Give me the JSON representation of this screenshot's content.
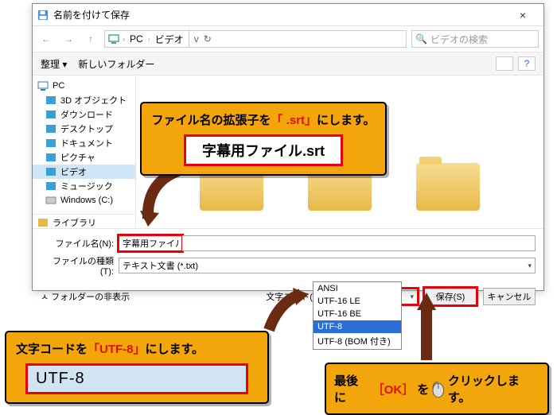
{
  "window": {
    "title": "名前を付けて保存",
    "close": "×"
  },
  "nav": {
    "back": "←",
    "fwd": "→",
    "up": "↑",
    "crumbs": [
      "PC",
      "ビデオ"
    ],
    "dropdown": "v",
    "refresh": "↻",
    "search_placeholder": "ビデオの検索"
  },
  "toolbar": {
    "organize": "整理 ▾",
    "newfolder": "新しいフォルダー"
  },
  "sidebar": {
    "pc": "PC",
    "items": [
      {
        "label": "3D オブジェクト"
      },
      {
        "label": "ダウンロード"
      },
      {
        "label": "デスクトップ"
      },
      {
        "label": "ドキュメント"
      },
      {
        "label": "ピクチャ"
      },
      {
        "label": "ビデオ"
      },
      {
        "label": "ミュージック"
      },
      {
        "label": "Windows (C:)"
      }
    ],
    "library": "ライブラリ"
  },
  "filename": {
    "label": "ファイル名(N):",
    "value": "字幕用ファイル.srt"
  },
  "filetype": {
    "label": "ファイルの種類(T):",
    "value": "テキスト文書 (*.txt)"
  },
  "footer": {
    "hide": "ㅅ フォルダーの非表示",
    "enc_label": "文字コード(E):",
    "enc_value": "UTF-8",
    "save": "保存(S)",
    "cancel": "キャンセル"
  },
  "enc_options": [
    "ANSI",
    "UTF-16 LE",
    "UTF-16 BE",
    "UTF-8",
    "UTF-8 (BOM 付き)"
  ],
  "callouts": {
    "c1_pre": "ファイル名の拡張子を",
    "c1_mid": "「 .srt」",
    "c1_post": "にします。",
    "c1_box": "字幕用ファイル.srt",
    "c2_pre": "文字コードを",
    "c2_mid": "「UTF-8」",
    "c2_post": "にします。",
    "c2_box": "UTF-8",
    "c3_pre": "最後に",
    "c3_mid": "［OK］",
    "c3_post": "を",
    "c3_end": "クリックします。"
  }
}
